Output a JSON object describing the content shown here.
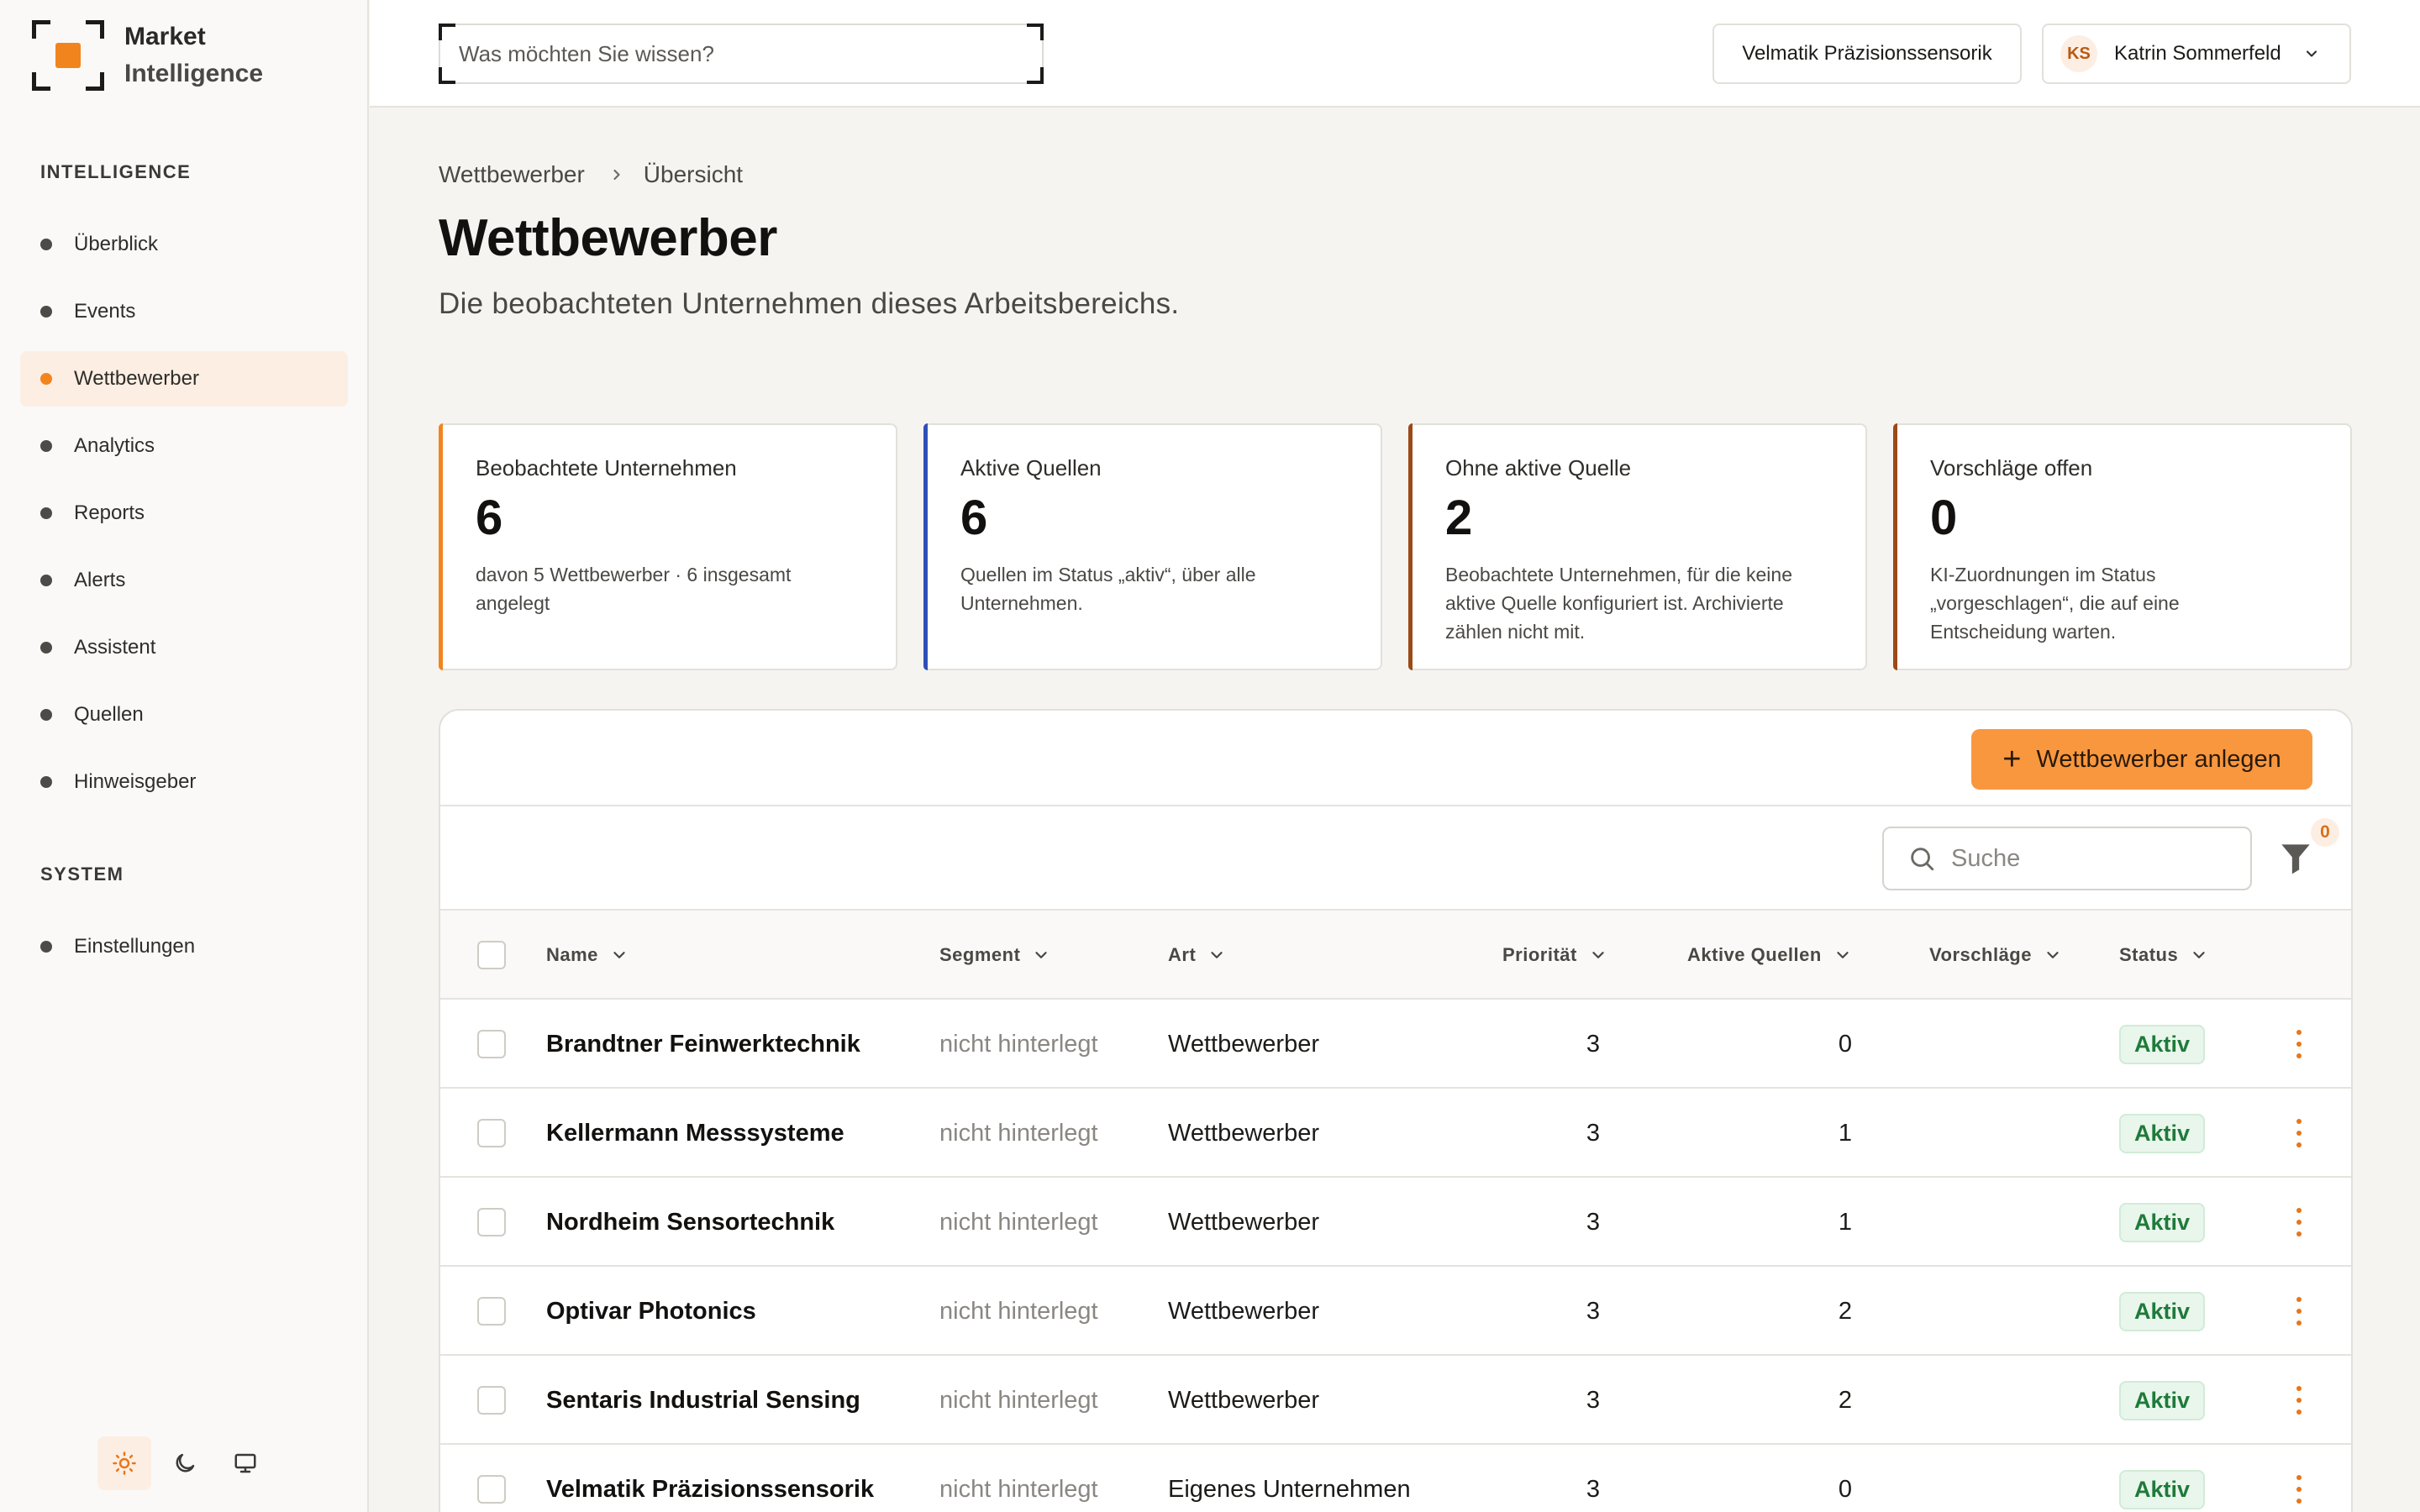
{
  "app": {
    "name_line1": "Market",
    "name_line2": "Intelligence"
  },
  "colors": {
    "accent": "#f2841d",
    "primary_button": "#f9973f",
    "status_active": "#1f7a3a"
  },
  "sidebar": {
    "section1": "INTELLIGENCE",
    "items": [
      {
        "label": "Überblick",
        "active": false
      },
      {
        "label": "Events",
        "active": false
      },
      {
        "label": "Wettbewerber",
        "active": true
      },
      {
        "label": "Analytics",
        "active": false
      },
      {
        "label": "Reports",
        "active": false
      },
      {
        "label": "Alerts",
        "active": false
      },
      {
        "label": "Assistent",
        "active": false
      },
      {
        "label": "Quellen",
        "active": false
      },
      {
        "label": "Hinweisgeber",
        "active": false
      }
    ],
    "section2": "SYSTEM",
    "system_items": [
      {
        "label": "Einstellungen"
      }
    ],
    "theme_options": [
      "sun-icon",
      "moon-icon",
      "monitor-icon"
    ],
    "theme_active": "sun-icon"
  },
  "topbar": {
    "search_placeholder": "Was möchten Sie wissen?",
    "company": "Velmatik Präzisionssensorik",
    "user_initials": "KS",
    "user_name": "Katrin Sommerfeld"
  },
  "breadcrumb": [
    "Wettbewerber",
    "Übersicht"
  ],
  "page": {
    "title": "Wettbewerber",
    "subtitle": "Die beobachteten Unternehmen dieses Arbeitsbereichs."
  },
  "stats": [
    {
      "label": "Beobachtete Unternehmen",
      "value": "6",
      "desc": "davon 5 Wettbewerber · 6 insgesamt angelegt",
      "accent": "#f2841d"
    },
    {
      "label": "Aktive Quellen",
      "value": "6",
      "desc": "Quellen im Status „aktiv“, über alle Unternehmen.",
      "accent": "#2f4fb8"
    },
    {
      "label": "Ohne aktive Quelle",
      "value": "2",
      "desc": "Beobachtete Unternehmen, für die keine aktive Quelle konfiguriert ist. Archivierte zählen nicht mit.",
      "accent": "#9a4a16"
    },
    {
      "label": "Vorschläge offen",
      "value": "0",
      "desc": "KI-Zuordnungen im Status „vorgeschlagen“, die auf eine Entscheidung warten.",
      "accent": "#9a4a16"
    }
  ],
  "table": {
    "add_button": "Wettbewerber anlegen",
    "search_placeholder": "Suche",
    "filter_count": "0",
    "columns": [
      "Name",
      "Segment",
      "Art",
      "Priorität",
      "Aktive Quellen",
      "Vorschläge",
      "Status"
    ],
    "rows": [
      {
        "name": "Brandtner Feinwerktechnik",
        "segment": "nicht hinterlegt",
        "art": "Wettbewerber",
        "prio": "3",
        "quellen": "0",
        "vorschlaege": "",
        "status": "Aktiv"
      },
      {
        "name": "Kellermann Messsysteme",
        "segment": "nicht hinterlegt",
        "art": "Wettbewerber",
        "prio": "3",
        "quellen": "1",
        "vorschlaege": "",
        "status": "Aktiv"
      },
      {
        "name": "Nordheim Sensortechnik",
        "segment": "nicht hinterlegt",
        "art": "Wettbewerber",
        "prio": "3",
        "quellen": "1",
        "vorschlaege": "",
        "status": "Aktiv"
      },
      {
        "name": "Optivar Photonics",
        "segment": "nicht hinterlegt",
        "art": "Wettbewerber",
        "prio": "3",
        "quellen": "2",
        "vorschlaege": "",
        "status": "Aktiv"
      },
      {
        "name": "Sentaris Industrial Sensing",
        "segment": "nicht hinterlegt",
        "art": "Wettbewerber",
        "prio": "3",
        "quellen": "2",
        "vorschlaege": "",
        "status": "Aktiv"
      },
      {
        "name": "Velmatik Präzisionssensorik",
        "segment": "nicht hinterlegt",
        "art": "Eigenes Unternehmen",
        "prio": "3",
        "quellen": "0",
        "vorschlaege": "",
        "status": "Aktiv"
      }
    ]
  }
}
